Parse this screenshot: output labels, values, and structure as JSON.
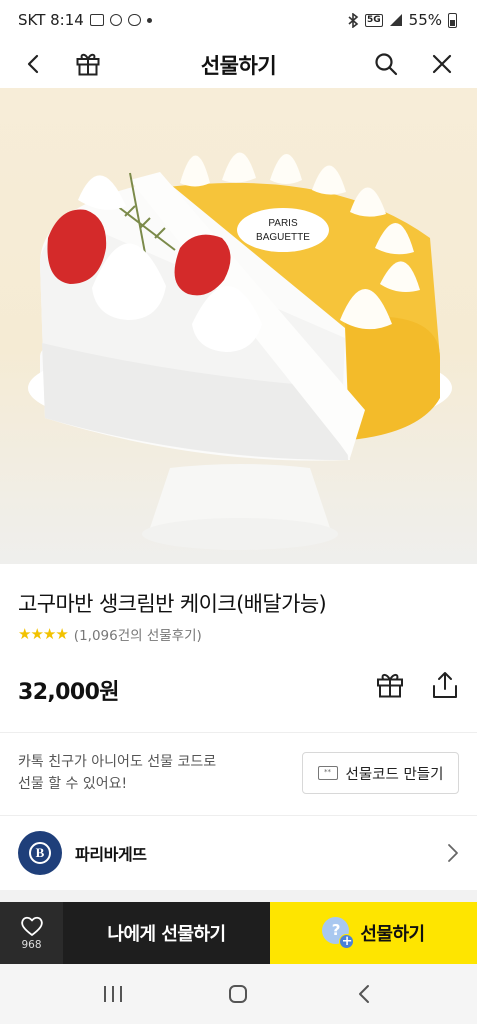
{
  "status_bar": {
    "carrier_time": "SKT 8:14",
    "network": "5G",
    "battery": "55%"
  },
  "header": {
    "title": "선물하기",
    "icons": [
      "back-icon",
      "gift-box-icon",
      "search-icon",
      "close-icon"
    ]
  },
  "hero": {
    "plaque_line1": "PARIS",
    "plaque_line2": "BAGUETTE"
  },
  "product": {
    "name": "고구마반 생크림반 케이크(배달가능)",
    "stars": "★★★★",
    "rating_value": 4,
    "review_count": "(1,096건의 선물후기)",
    "price": "32,000원"
  },
  "gift_code": {
    "description_line1": "카톡 친구가 아니어도 선물 코드로",
    "description_line2": "선물 할 수 있어요!",
    "button_label": "선물코드 만들기"
  },
  "brand": {
    "logo_letter": "B",
    "name": "파리바게뜨"
  },
  "bottom_bar": {
    "like_count": "968",
    "gift_self_label": "나에게 선물하기",
    "gift_label": "선물하기",
    "friend_icon_text": "?",
    "plus_text": "+"
  },
  "colors": {
    "accent_yellow": "#fee500",
    "dark_button": "#1e1e1e",
    "star": "#f2c200",
    "brand_blue": "#1f3f7a"
  }
}
